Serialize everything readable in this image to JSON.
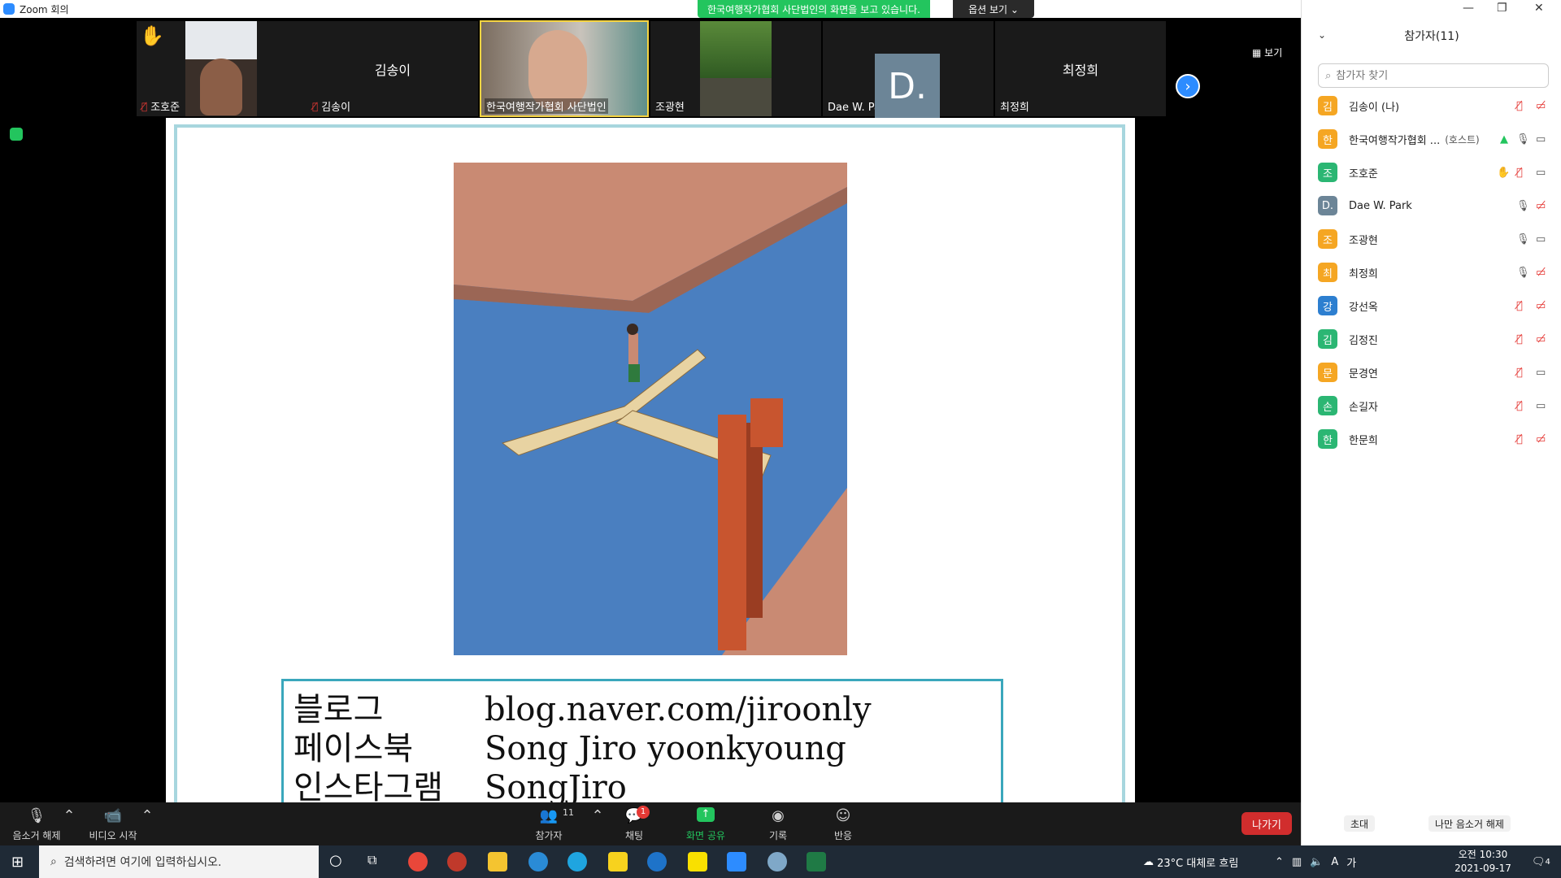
{
  "window": {
    "title": "Zoom 회의"
  },
  "share_banner": {
    "text": "한국여행작가협회 사단법인의 화면을 보고 있습니다.",
    "options_label": "옵션 보기 ⌄"
  },
  "strip": {
    "view_label": "보기",
    "tiles": [
      {
        "name": "조호준"
      },
      {
        "name": "김송이",
        "center": "김송이"
      },
      {
        "name": "한국여행작가협회 사단법인"
      },
      {
        "name": "조광현"
      },
      {
        "name": "Dae W. Park",
        "initial": "D."
      },
      {
        "name": "최정희",
        "center": "최정희"
      }
    ]
  },
  "slide": {
    "rows": [
      {
        "k": "블로그",
        "v": "blog.naver.com/jiroonly"
      },
      {
        "k": "페이스북",
        "v": "Song Jiro yoonkyoung"
      },
      {
        "k": "인스타그램",
        "v": "SongJiro"
      }
    ]
  },
  "toolbar": {
    "mute_label": "음소거 해제",
    "video_label": "비디오 시작",
    "participants_label": "참가자",
    "participants_count": "11",
    "chat_label": "채팅",
    "chat_badge": "1",
    "share_label": "화면 공유",
    "record_label": "기록",
    "react_label": "반응",
    "leave_label": "나가기"
  },
  "panel": {
    "title": "참가자(11)",
    "search_placeholder": "참가자 찾기",
    "invite_label": "초대",
    "unmute_me_label": "나만 음소거 해제",
    "participants": [
      {
        "avatar": "김",
        "color": "#f5a623",
        "name": "김송이 (나)",
        "tag": ""
      },
      {
        "avatar": "한",
        "color": "#f5a623",
        "name": "한국여행작가협회 ...",
        "tag": "(호스트)"
      },
      {
        "avatar": "조",
        "color": "#2bb673",
        "name": "조호준",
        "tag": ""
      },
      {
        "avatar": "D.",
        "color": "#6c8597",
        "name": "Dae W. Park",
        "tag": ""
      },
      {
        "avatar": "조",
        "color": "#f5a623",
        "name": "조광현",
        "tag": ""
      },
      {
        "avatar": "최",
        "color": "#f5a623",
        "name": "최정희",
        "tag": ""
      },
      {
        "avatar": "강",
        "color": "#2d7fd0",
        "name": "강선옥",
        "tag": ""
      },
      {
        "avatar": "김",
        "color": "#2bb673",
        "name": "김정진",
        "tag": ""
      },
      {
        "avatar": "문",
        "color": "#f5a623",
        "name": "문경연",
        "tag": ""
      },
      {
        "avatar": "손",
        "color": "#2bb673",
        "name": "손길자",
        "tag": ""
      },
      {
        "avatar": "한",
        "color": "#2bb673",
        "name": "한문희",
        "tag": ""
      }
    ]
  },
  "taskbar": {
    "search_placeholder": "검색하려면 여기에 입력하십시오.",
    "weather": "23°C  대체로 흐림",
    "time": "오전 10:30",
    "date": "2021-09-17",
    "notif_count": "4"
  }
}
